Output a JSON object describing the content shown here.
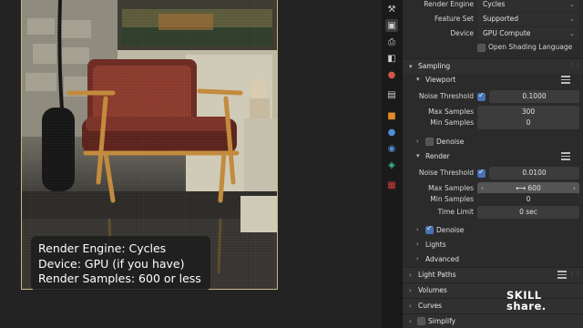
{
  "caption": {
    "line1": "Render Engine: Cycles",
    "line2": "Device: GPU (if you have)",
    "line3": "Render Samples: 600 or less"
  },
  "render": {
    "label_render_engine": "Render Engine",
    "render_engine": "Cycles",
    "label_feature_set": "Feature Set",
    "feature_set": "Supported",
    "label_device": "Device",
    "device": "GPU Compute",
    "open_shading_language": "Open Shading Language"
  },
  "sampling": {
    "title": "Sampling",
    "viewport": {
      "title": "Viewport",
      "noise_threshold_label": "Noise Threshold",
      "noise_threshold": "0.1000",
      "max_samples_label": "Max Samples",
      "max_samples": "300",
      "min_samples_label": "Min Samples",
      "min_samples": "0",
      "denoise": "Denoise"
    },
    "render": {
      "title": "Render",
      "noise_threshold_label": "Noise Threshold",
      "noise_threshold": "0.0100",
      "max_samples_label": "Max Samples",
      "max_samples": "600",
      "min_samples_label": "Min Samples",
      "min_samples": "0",
      "time_limit_label": "Time Limit",
      "time_limit": "0 sec",
      "denoise": "Denoise",
      "lights": "Lights",
      "advanced": "Advanced"
    }
  },
  "panels": {
    "light_paths": "Light Paths",
    "volumes": "Volumes",
    "curves": "Curves",
    "simplify": "Simplify"
  },
  "watermark": {
    "line1": "SKILL",
    "line2": "share."
  },
  "colors": {
    "accent": "#4772b3",
    "panel_bg": "#2b2b2b",
    "field_bg": "#3c3c3c"
  }
}
